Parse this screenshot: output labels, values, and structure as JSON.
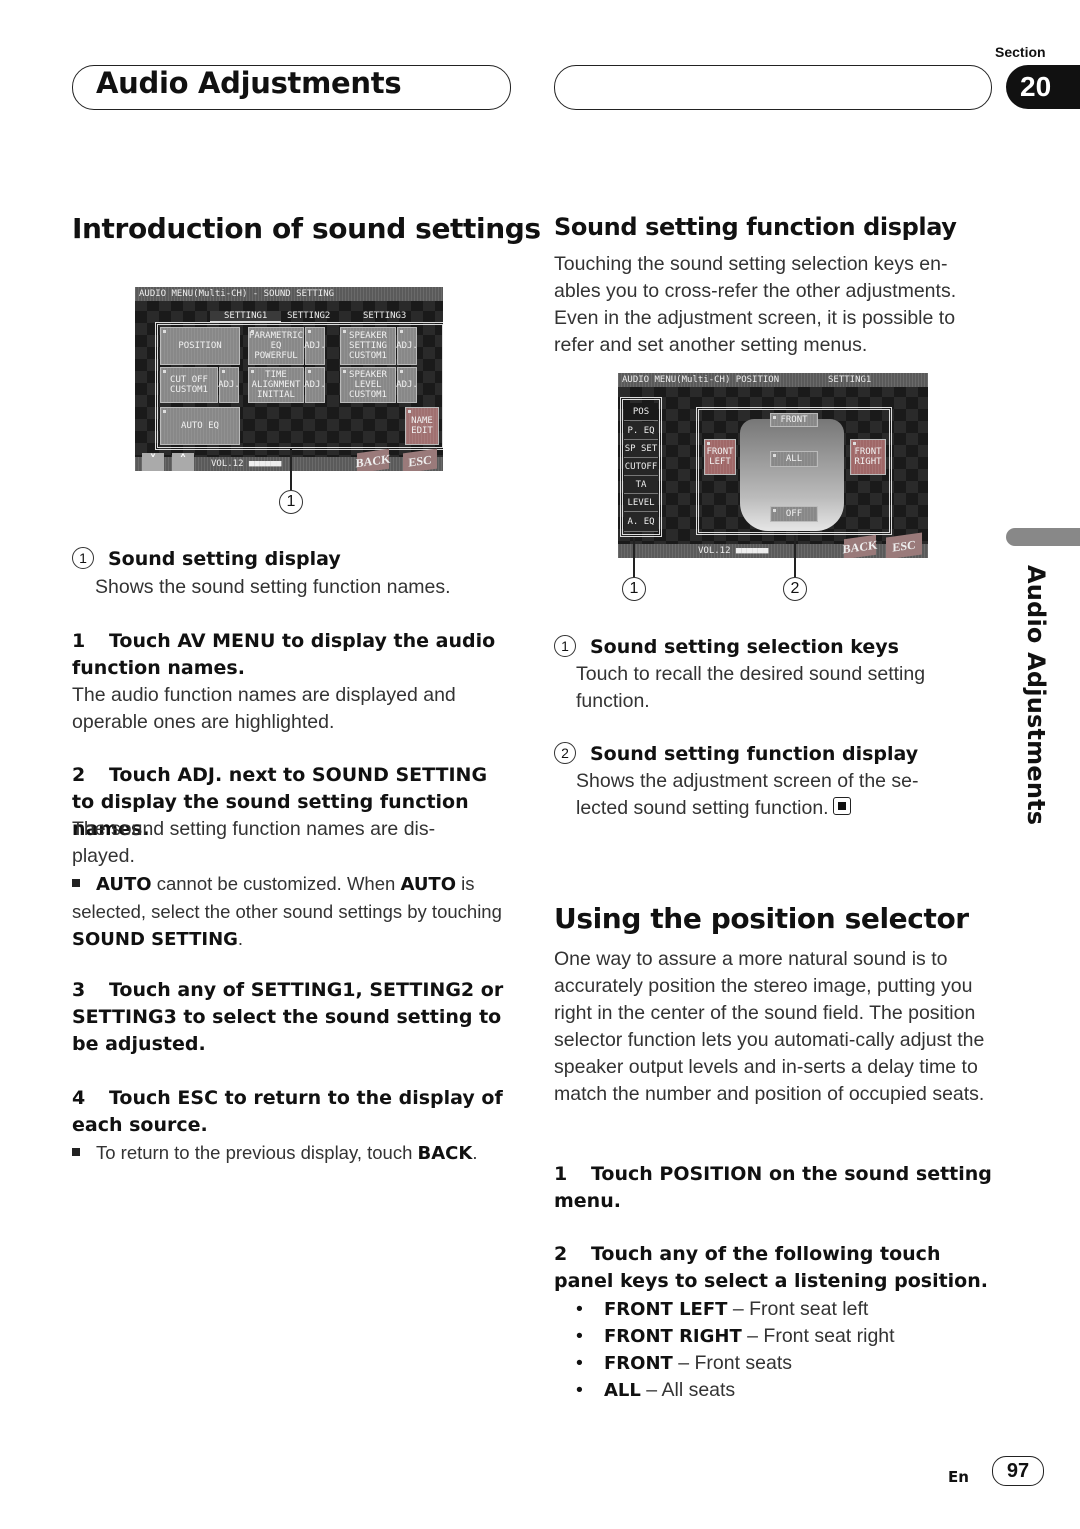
{
  "header": {
    "title": "Audio Adjustments",
    "section_label": "Section",
    "section_number": "20"
  },
  "left": {
    "heading": "Introduction of sound settings",
    "screen1": {
      "title_bar": "AUDIO MENU(Multi-CH) - SOUND SETTING",
      "tabs": [
        "SETTING1",
        "SETTING2",
        "SETTING3"
      ],
      "buttons": {
        "position": "POSITION",
        "parametric_eq": "PARAMETRIC EQ POWERFUL",
        "speaker_setting": "SPEAKER SETTING CUSTOM1",
        "cut_off": "CUT OFF CUSTOM1",
        "time_alignment": "TIME ALIGNMENT INITIAL",
        "speaker_level": "SPEAKER LEVEL CUSTOM1",
        "auto_eq": "AUTO EQ",
        "name_edit": "NAME EDIT",
        "adj": "ADJ."
      },
      "volume": "VOL.12 ■■■■■■",
      "back": "BACK",
      "esc": "ESC",
      "down_arrow": "˅",
      "up_arrow": "˄",
      "callout": "1"
    },
    "callout_1": {
      "marker": "1",
      "title": "Sound setting display",
      "text": "Shows the sound setting function names."
    },
    "steps": [
      {
        "num": "1",
        "title": "Touch AV MENU to display the audio function names.",
        "text": "The audio function names are displayed and operable ones are highlighted."
      },
      {
        "num": "2",
        "title": "Touch ADJ. next to SOUND SETTING to display the sound setting function names.",
        "text": "The sound setting function names are dis-played.",
        "note_pre": "AUTO",
        "note_mid": " cannot be customized. When ",
        "note_kw2": "AUTO",
        "note_mid2": " is selected, select the other sound settings by touching ",
        "note_kw3": "SOUND SETTING",
        "note_end": "."
      },
      {
        "num": "3",
        "title": "Touch any of SETTING1, SETTING2 or SETTING3 to select the sound setting to be adjusted."
      },
      {
        "num": "4",
        "title": "Touch ESC to return to the display of each source.",
        "note_pre": "To return to the previous display, touch ",
        "note_kw": "BACK",
        "note_end": "."
      }
    ]
  },
  "right": {
    "heading": "Sound setting function display",
    "intro": "Touching the sound setting selection keys en-ables you to cross-refer the other adjustments. Even in the adjustment screen, it is possible to refer and set another setting menus.",
    "screen2": {
      "title_bar": "AUDIO MENU(Multi-CH) POSITION",
      "setting_label": "SETTING1",
      "side_keys": [
        "POS",
        "P. EQ",
        "SP SET",
        "CUTOFF",
        "TA",
        "LEVEL",
        "A. EQ"
      ],
      "position_keys": {
        "front": "FRONT",
        "front_left": "FRONT LEFT",
        "front_right": "FRONT RIGHT",
        "all": "ALL",
        "off": "OFF"
      },
      "volume": "VOL.12 ■■■■■■",
      "back": "BACK",
      "esc": "ESC",
      "callouts": [
        "1",
        "2"
      ]
    },
    "callouts": [
      {
        "marker": "1",
        "title": "Sound setting selection keys",
        "text": "Touch to recall the desired sound setting function."
      },
      {
        "marker": "2",
        "title": "Sound setting function display",
        "text": "Shows the adjustment screen of the se-lected sound setting function."
      }
    ],
    "heading2": "Using the position selector",
    "body2": "One way to assure a more natural sound is to accurately position the stereo image, putting you right in the center of the sound field. The position selector function lets you automati-cally adjust the speaker output levels and in-serts a delay time to match the number and position of occupied seats.",
    "steps": [
      {
        "num": "1",
        "title": "Touch POSITION on the sound setting menu."
      },
      {
        "num": "2",
        "title": "Touch any of the following touch panel keys to select a listening position."
      }
    ],
    "options": [
      {
        "key": "FRONT LEFT",
        "desc": " – Front seat left"
      },
      {
        "key": "FRONT RIGHT",
        "desc": " – Front seat right"
      },
      {
        "key": "FRONT",
        "desc": " – Front seats"
      },
      {
        "key": "ALL",
        "desc": " – All seats"
      }
    ]
  },
  "side_tab": {
    "label": "Audio Adjustments"
  },
  "footer": {
    "lang": "En",
    "page": "97"
  }
}
